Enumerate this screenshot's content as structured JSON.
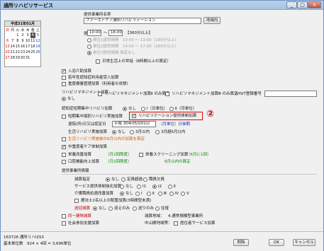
{
  "window": {
    "title": "通所リハビリサービス"
  },
  "calendar": {
    "title": "平成31年01月",
    "weekdays": [
      "日",
      "月",
      "火",
      "水",
      "木",
      "金",
      "土"
    ],
    "weeks": [
      [
        "",
        "",
        "1",
        "2",
        "3",
        "4",
        "5"
      ],
      [
        "6",
        "7",
        "8",
        "9",
        "10",
        "11",
        "12"
      ],
      [
        "13",
        "14",
        "15",
        "16",
        "17",
        "18",
        "19"
      ],
      [
        "20",
        "21",
        "22",
        "23",
        "24",
        "25",
        "26"
      ],
      [
        "27",
        "28",
        "29",
        "30",
        "31",
        "",
        ""
      ]
    ],
    "selected": "4"
  },
  "provider": {
    "label": "提供事業所名称",
    "value": "ファーストケア通所リハビリテーション",
    "btn": "地域内"
  },
  "time": {
    "label": "提供時間",
    "start": "10:00",
    "tilde": "〜",
    "end": "16:00",
    "duration": "【360分以上】"
  },
  "units": [
    "単位1提供時間　10:00 〜 13:00（180分以上）",
    "単位2提供時間　14:00 〜 17:00（180分以上）",
    "単位3提供時間 設定なし"
  ],
  "daily_life": "日常生活上の世話（8時間以上の算定）",
  "add_items": [
    "入浴介助加算",
    "若年性認知症利用者受入加算",
    "重度療養管理加算（利用者の状態）"
  ],
  "rehab_mgmt": {
    "label": "リハビリマネジメント加算",
    "none": "なし",
    "opts": [
      "リハビリマネジメント加算Ⅱ のみ算定",
      "リハビリマネジメント加算Ⅲ のみ算定"
    ],
    "visit_label": "VISIT登録番号"
  },
  "cog_rehab": {
    "label": "認知症短期集中リハビリ加算",
    "opts": [
      "なし",
      "Ⅰ（日単位）",
      "Ⅱ（月単位）"
    ]
  },
  "short_rehab": {
    "label": "短期集中個別リハビリ実施加算",
    "highlight": "リハビリテーション提供体制加算",
    "circle": "②"
  },
  "move_date": {
    "label": "退院(所)日又は認定日",
    "value": "平成 30年05月01日",
    "note": "（月単位）日後期"
  },
  "life_act": {
    "label": "生活リハビリ実施加算",
    "opts": [
      "なし",
      "3月以内",
      "3月超6月以内"
    ]
  },
  "life_act_sub": "生活リハビリ実施後の6月以内の加算を算定",
  "mid_care": "中重度者ケア体制加算",
  "nutrition": {
    "label": "栄養改善加算",
    "note": "（月2回限度）"
  },
  "nutrition_screen": {
    "label": "栄養スクリーニング加算",
    "note": "（6月に1回）"
  },
  "oral": {
    "label": "口腔機能向上加算",
    "note": "（月2回限度）",
    "note2": "6月以内の算定"
  },
  "staff": {
    "label": "提供事業所情報",
    "reduce": {
      "label": "減算指定",
      "opts": [
        "なし",
        "定員超過",
        "職員欠員"
      ]
    },
    "service": {
      "label": "サービス提供体制強化加算",
      "opts": [
        "なし",
        "Ⅰ1",
        "Ⅰ2",
        "Ⅱ"
      ]
    },
    "care_staff": {
      "label": "介護職員処遇改善加算",
      "opts": [
        "なし",
        "Ⅰ",
        "Ⅱ",
        "Ⅲ",
        "Ⅳ",
        "Ⅴ"
      ]
    },
    "medical": "療法士2名以上の配置加算(3時間型未満)",
    "transport": {
      "label": "送迎減算",
      "opts": [
        "なし",
        "迎えのみ",
        "送りのみ",
        "往復"
      ]
    },
    "same_building": "同一建物減算",
    "reduce_area": "減算地域：",
    "addr": "4.通常規模型事業所",
    "social": "社会参加支援加算",
    "mid_label": "中山間地域等：",
    "mid_val": "居住者サービス加算"
  },
  "status": {
    "line1": "163726 通所リハⅠ2S3",
    "line2": "基本単位数　924 × 4回 = 3,696単位"
  },
  "buttons": {
    "del": "削除",
    "ok": "OK",
    "cancel": "キャンセル"
  }
}
